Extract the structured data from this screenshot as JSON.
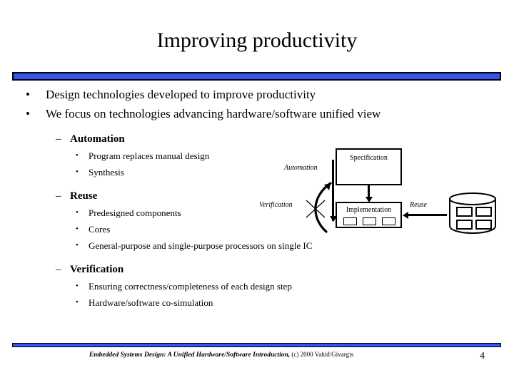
{
  "slide": {
    "title": "Improving productivity",
    "page_number": "4",
    "accent_color": "#3355ee",
    "bullet_glyph_level1": "•",
    "bullet_glyph_level2": "–",
    "bullet_glyph_level3": "•"
  },
  "bullets": {
    "level1": [
      "Design technologies developed to improve productivity",
      "We focus on technologies advancing hardware/software unified view"
    ],
    "groups": [
      {
        "heading": "Automation",
        "items": [
          "Program replaces manual design",
          "Synthesis"
        ]
      },
      {
        "heading": "Reuse",
        "items": [
          "Predesigned components",
          "Cores",
          "General-purpose and single-purpose processors on single IC"
        ]
      },
      {
        "heading": "Verification",
        "items": [
          "Ensuring correctness/completeness of each design step",
          "Hardware/software co-simulation"
        ]
      }
    ]
  },
  "diagram": {
    "labels": {
      "automation": "Automation",
      "verification": "Verification",
      "reuse": "Reuse"
    },
    "boxes": {
      "specification": "Specification",
      "implementation": "Implementation"
    }
  },
  "footer": {
    "book_title": "Embedded Systems Design: A Unified Hardware/Software Introduction,",
    "copyright": "(c) 2000 Vahid/Givargis"
  }
}
